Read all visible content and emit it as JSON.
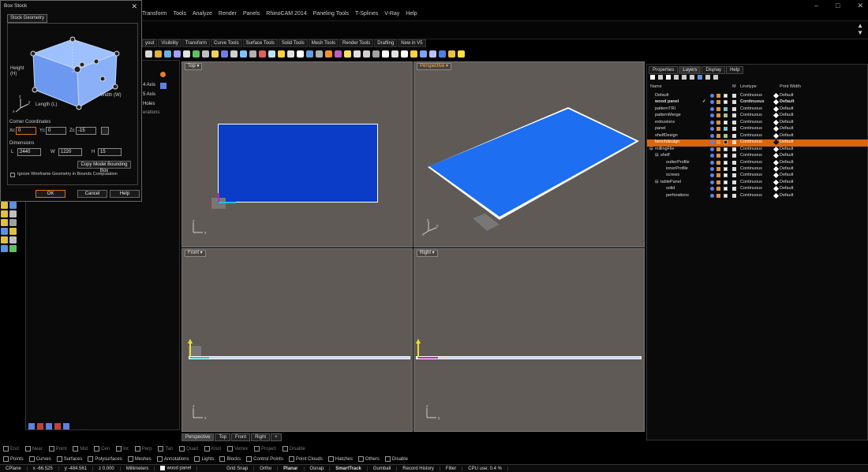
{
  "menubar": [
    "Transform",
    "Tools",
    "Analyze",
    "Render",
    "Panels",
    "RhinoCAM 2014",
    "Paneling Tools",
    "T-Splines",
    "V-Ray",
    "Help"
  ],
  "window_controls": [
    "–",
    "□",
    "✕"
  ],
  "command_right": [
    "▲",
    "▼"
  ],
  "toolbar_tabs": [
    "yout",
    "Visibility",
    "Transform",
    "Curve Tools",
    "Surface Tools",
    "Solid Tools",
    "Mesh Tools",
    "Render Tools",
    "Drafting",
    "New in V5"
  ],
  "toolbar_icon_colors": [
    "#d8d8d8",
    "#e0b040",
    "#6ab0e0",
    "#a0a0ff",
    "#e0e0e0",
    "#60c060",
    "#c0c0c0",
    "#f0d060",
    "#7080e0",
    "#d0d0d0",
    "#80c0ff",
    "#b0b0b0",
    "#e06060",
    "#c0e0ff",
    "#ffd040",
    "#e0e0e0",
    "#ffffff",
    "#60a0e0",
    "#b0b0b0",
    "#f09030",
    "#c060c0",
    "#ffe060",
    "#e0e0e0",
    "#d0d0d0",
    "#a0a0a0",
    "#ffffff",
    "#e0e0e0",
    "#ffffff",
    "#ffd040",
    "#80a0ff",
    "#c0c0ff",
    "#5080e0",
    "#f0c040",
    "#ffe040"
  ],
  "left_panel": {
    "axis1": "4 Axis",
    "axis2": "5 Axis",
    "holes": "Holes",
    "operations": "erations"
  },
  "dialog": {
    "title": "Box Stock",
    "close": "✕",
    "tab": "Stock Geometry",
    "height_label": "Height\n(H)",
    "length_label": "Length (L)",
    "width_label": "Width (W)",
    "corner_heading": "Corner Coordinates",
    "x_label": "Xc",
    "x_value": "0",
    "y_label": "Yc",
    "y_value": "0",
    "z_label": "Zc",
    "z_value": "-15",
    "dims_heading": "Dimensions",
    "l_label": "L",
    "l_value": "2440",
    "w_label": "W",
    "w_value": "1220",
    "h_label": "H",
    "h_value": "15",
    "copy_bbox": "Copy Model Bounding Box",
    "ignore_wire": "Ignore Wireframe Geometry in Bounds Computation",
    "ok": "OK",
    "cancel": "Cancel",
    "help": "Help"
  },
  "viewports": {
    "top": "Top",
    "perspective": "Perspective",
    "front": "Front",
    "right": "Right"
  },
  "viewport_tabs": [
    "Perspective",
    "Top",
    "Front",
    "Right",
    "+"
  ],
  "right_panel": {
    "tabs": [
      "Properties",
      "Layers",
      "Display",
      "Help"
    ],
    "headers": {
      "name": "Name",
      "m": "M",
      "linetype": "Linetype",
      "printwidth": "Print Width"
    },
    "layers": [
      {
        "name": "Default",
        "indent": 0,
        "color": "#ffffff",
        "linetype": "Continuous",
        "print": "Default"
      },
      {
        "name": "wood panel",
        "indent": 0,
        "color": "#ffffff",
        "linetype": "Continuous",
        "print": "Default",
        "current": true
      },
      {
        "name": "patternTRI",
        "indent": 0,
        "color": "#40e0e0",
        "linetype": "Continuous",
        "print": "Default"
      },
      {
        "name": "patternMerge",
        "indent": 0,
        "color": "#a0e040",
        "linetype": "Continuous",
        "print": "Default"
      },
      {
        "name": "extrusions",
        "indent": 0,
        "color": "#ffffff",
        "linetype": "Continuous",
        "print": "Default"
      },
      {
        "name": "panel",
        "indent": 0,
        "color": "#40e0e0",
        "linetype": "Continuous",
        "print": "Default"
      },
      {
        "name": "shelfDesign",
        "indent": 0,
        "color": "#a0e040",
        "linetype": "Continuous",
        "print": "Default"
      },
      {
        "name": "benchdesign",
        "indent": 0,
        "color": "#000000",
        "linetype": "Continuous",
        "print": "Default",
        "selected": true
      },
      {
        "name": "millingFile",
        "indent": 0,
        "color": "#ffffff",
        "linetype": "Continuous",
        "print": "Default",
        "expand": "⊟"
      },
      {
        "name": "shelf",
        "indent": 1,
        "color": "#ffffff",
        "linetype": "Continuous",
        "print": "Default",
        "expand": "⊟"
      },
      {
        "name": "outterProfile",
        "indent": 2,
        "color": "#ffffff",
        "linetype": "Continuous",
        "print": "Default"
      },
      {
        "name": "innerProfile",
        "indent": 2,
        "color": "#ffffff",
        "linetype": "Continuous",
        "print": "Default"
      },
      {
        "name": "screws",
        "indent": 2,
        "color": "#ffffff",
        "linetype": "Continuous",
        "print": "Default"
      },
      {
        "name": "tablePanel",
        "indent": 1,
        "color": "#ffffff",
        "linetype": "Continuous",
        "print": "Default",
        "expand": "⊟"
      },
      {
        "name": "solid",
        "indent": 2,
        "color": "#ffffff",
        "linetype": "Continuous",
        "print": "Default"
      },
      {
        "name": "perforations",
        "indent": 2,
        "color": "#ffffff",
        "linetype": "Continuous",
        "print": "Default"
      }
    ]
  },
  "osnap": [
    "End",
    "Near",
    "Point",
    "Mid",
    "Cen",
    "Int",
    "Perp",
    "Tan",
    "Quad",
    "Knot",
    "Vertex",
    "Project",
    "Disable"
  ],
  "filters": [
    "Points",
    "Curves",
    "Surfaces",
    "Polysurfaces",
    "Meshes",
    "Annotations",
    "Lights",
    "Blocks",
    "Control Points",
    "Point Clouds",
    "Hatches",
    "Others",
    "Disable"
  ],
  "status": {
    "cplane": "CPlane",
    "x": "x -66.525",
    "y": "y -484.561",
    "z": "z 0.000",
    "units": "Millimeters",
    "layer": "wood panel",
    "grid_snap": "Grid Snap",
    "ortho": "Ortho",
    "planar": "Planar",
    "osnap": "Osnap",
    "smarttrack": "SmartTrack",
    "gumball": "Gumball",
    "record": "Record History",
    "filter": "Filter",
    "cpu": "CPU use: 0.4 %"
  }
}
